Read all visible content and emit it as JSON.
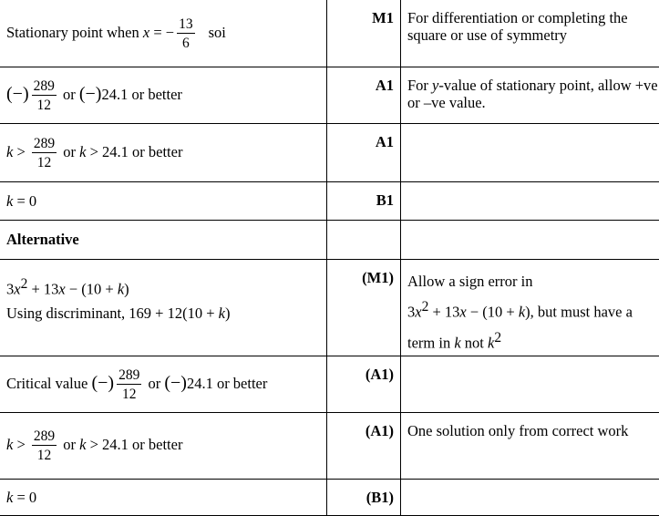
{
  "rows": [
    {
      "work": {
        "pre": "Stationary point when",
        "var": "x",
        "eq": " = −",
        "num": "13",
        "den": "6",
        "post": "soi"
      },
      "mark": "M1",
      "note": "For differentiation or completing the square or use of symmetry"
    },
    {
      "work": {
        "neg": "(−)",
        "num": "289",
        "den": "12",
        "mid": "or",
        "neg2": "(−)",
        "dec": "24.1",
        "post": "or better"
      },
      "mark": "A1",
      "note": {
        "pre": "For ",
        "ital": "y",
        "post": "-value of stationary point, allow +ve or –ve value."
      }
    },
    {
      "work": {
        "var": "k",
        "op": " > ",
        "num": "289",
        "den": "12",
        "mid": "or",
        "var2": "k",
        "op2": " > 24.1",
        "post": "or better"
      },
      "mark": "A1",
      "note": ""
    },
    {
      "work": {
        "var": "k",
        "rest": " = 0"
      },
      "mark": "B1",
      "note": ""
    },
    {
      "work": {
        "heading": "Alternative"
      },
      "mark": "",
      "note": ""
    },
    {
      "work": {
        "line1_a": "3",
        "line1_x": "x",
        "line1_sup": "2",
        "line1_b": " + 13",
        "line1_x2": "x",
        "line1_c": " − (10 + ",
        "line1_k": "k",
        "line1_d": ")",
        "line2_pre": "Using discriminant, ",
        "line2_a": "169 + 12(10 + ",
        "line2_k": "k",
        "line2_b": ")"
      },
      "mark": "(M1)",
      "note": {
        "l1": "Allow a sign error in",
        "expr_a": "3",
        "expr_x": "x",
        "expr_sup": "2",
        "expr_b": " + 13",
        "expr_x2": "x",
        "expr_c": " − (10 + ",
        "expr_k": "k",
        "expr_d": ")",
        "expr_post": ", but must have a",
        "l3_pre": "term in ",
        "l3_k": "k",
        "l3_mid": " not ",
        "l3_k2": "k",
        "l3_sup": "2"
      }
    },
    {
      "work": {
        "pre": "Critical value",
        "neg": "(−)",
        "num": "289",
        "den": "12",
        "mid": "or",
        "neg2": "(−)",
        "dec": "24.1",
        "post": "or better"
      },
      "mark": "(A1)",
      "note": ""
    },
    {
      "work": {
        "var": "k",
        "op": " > ",
        "num": "289",
        "den": "12",
        "mid": "or",
        "var2": "k",
        "op2": " > 24.1",
        "post": "or better"
      },
      "mark": "(A1)",
      "note": "One solution only from correct work"
    },
    {
      "work": {
        "var": "k",
        "rest": " = 0"
      },
      "mark": "(B1)",
      "note": ""
    }
  ]
}
